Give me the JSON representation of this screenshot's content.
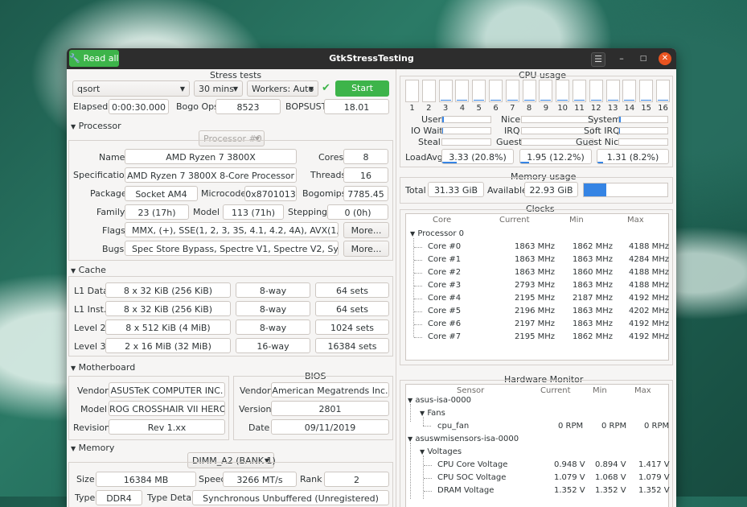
{
  "window": {
    "title": "GtkStressTesting",
    "read_all": "Read all"
  },
  "stress": {
    "title": "Stress tests",
    "method": "qsort",
    "duration": "30 mins",
    "workers": "Workers: Auto",
    "start": "Start",
    "elapsed_label": "Elapsed",
    "elapsed": "0:00:30.000",
    "bogo_label": "Bogo Ops",
    "bogo": "8523",
    "bopsust_label": "BOPSUST",
    "bopsust": "18.01"
  },
  "processor": {
    "title": "Processor",
    "selector": "Processor #0",
    "name_label": "Name",
    "name": "AMD Ryzen 7 3800X",
    "cores_label": "Cores",
    "cores": "8",
    "spec_label": "Specification",
    "spec": "AMD Ryzen 7 3800X 8-Core Processor",
    "threads_label": "Threads",
    "threads": "16",
    "package_label": "Package",
    "package": "Socket AM4",
    "microcode_label": "Microcode",
    "microcode": "0x8701013",
    "bogomips_label": "Bogomips",
    "bogomips": "7785.45",
    "family_label": "Family",
    "family": "23 (17h)",
    "model_label": "Model",
    "model": "113 (71h)",
    "stepping_label": "Stepping",
    "stepping": "0 (0h)",
    "flags_label": "Flags",
    "flags": "MMX, (+), SSE(1, 2, 3, 3S, 4.1, 4.2, 4A), AVX(1, 2), AES, CLM",
    "more1": "More...",
    "bugs_label": "Bugs",
    "bugs": "Spec Store Bypass, Spectre V1, Spectre V2, Sysret Ss Att",
    "more2": "More..."
  },
  "cache": {
    "title": "Cache",
    "rows": [
      {
        "label": "L1 Data",
        "size": "8 x 32 KiB (256 KiB)",
        "way": "8-way",
        "sets": "64 sets"
      },
      {
        "label": "L1 Inst.",
        "size": "8 x 32 KiB (256 KiB)",
        "way": "8-way",
        "sets": "64 sets"
      },
      {
        "label": "Level 2",
        "size": "8 x 512 KiB (4 MiB)",
        "way": "8-way",
        "sets": "1024 sets"
      },
      {
        "label": "Level 3",
        "size": "2 x 16 MiB (32 MiB)",
        "way": "16-way",
        "sets": "16384 sets"
      }
    ]
  },
  "motherboard": {
    "title": "Motherboard",
    "vendor_label": "Vendor",
    "vendor": "ASUSTeK COMPUTER INC.",
    "model_label": "Model",
    "model": "ROG CROSSHAIR VII HERO",
    "revision_label": "Revision",
    "revision": "Rev 1.xx",
    "bios_title": "BIOS",
    "bios_vendor_label": "Vendor",
    "bios_vendor": "American Megatrends Inc.",
    "version_label": "Version",
    "version": "2801",
    "date_label": "Date",
    "date": "09/11/2019"
  },
  "memory": {
    "title": "Memory",
    "selector": "DIMM_A2 (BANK 1)",
    "size_label": "Size",
    "size": "16384 MB",
    "speed_label": "Speed",
    "speed": "3266 MT/s",
    "rank_label": "Rank",
    "rank": "2",
    "type_label": "Type",
    "type": "DDR4",
    "detail_label": "Type Detail",
    "detail": "Synchronous Unbuffered (Unregistered)"
  },
  "cpu_usage": {
    "title": "CPU usage",
    "cores": [
      "1",
      "2",
      "3",
      "4",
      "5",
      "6",
      "7",
      "8",
      "9",
      "10",
      "11",
      "12",
      "13",
      "14",
      "15",
      "16"
    ],
    "core_levels": [
      0,
      0,
      0.05,
      0.05,
      0.05,
      0.05,
      0.05,
      0.05,
      0.05,
      0.05,
      0.05,
      0.05,
      0.05,
      0.05,
      0.05,
      0.05
    ],
    "user_label": "User",
    "nice_label": "Nice",
    "system_label": "System",
    "iowait_label": "IO Wait",
    "irq_label": "IRQ",
    "softirq_label": "Soft IRQ",
    "steal_label": "Steal",
    "guest_label": "Guest",
    "guestnice_label": "Guest Nice",
    "loadavg_label": "LoadAvg",
    "load1": "3.33 (20.8%)",
    "load5": "1.95 (12.2%)",
    "load15": "1.31 (8.2%)",
    "load_levels": [
      0.208,
      0.122,
      0.082
    ]
  },
  "memory_usage": {
    "title": "Memory usage",
    "total_label": "Total",
    "total": "31.33 GiB",
    "available_label": "Available",
    "available": "22.93 GiB",
    "used_fraction": 0.27
  },
  "clocks": {
    "title": "Clocks",
    "headers": [
      "Core",
      "Current",
      "Min",
      "Max"
    ],
    "group": "Processor 0",
    "rows": [
      {
        "core": "Core #0",
        "current": "1863 MHz",
        "min": "1862 MHz",
        "max": "4188 MHz"
      },
      {
        "core": "Core #1",
        "current": "1863 MHz",
        "min": "1863 MHz",
        "max": "4284 MHz"
      },
      {
        "core": "Core #2",
        "current": "1863 MHz",
        "min": "1860 MHz",
        "max": "4188 MHz"
      },
      {
        "core": "Core #3",
        "current": "2793 MHz",
        "min": "1863 MHz",
        "max": "4188 MHz"
      },
      {
        "core": "Core #4",
        "current": "2195 MHz",
        "min": "2187 MHz",
        "max": "4192 MHz"
      },
      {
        "core": "Core #5",
        "current": "2196 MHz",
        "min": "1863 MHz",
        "max": "4202 MHz"
      },
      {
        "core": "Core #6",
        "current": "2197 MHz",
        "min": "1863 MHz",
        "max": "4192 MHz"
      },
      {
        "core": "Core #7",
        "current": "2195 MHz",
        "min": "1862 MHz",
        "max": "4192 MHz"
      }
    ]
  },
  "hwmon": {
    "title": "Hardware Monitor",
    "headers": [
      "Sensor",
      "Current",
      "Min",
      "Max"
    ],
    "isa": "asus-isa-0000",
    "fans": "Fans",
    "fan_name": "cpu_fan",
    "fan_cur": "0 RPM",
    "fan_min": "0 RPM",
    "fan_max": "0 RPM",
    "wmi": "asuswmisensors-isa-0000",
    "voltages": "Voltages",
    "rows": [
      {
        "name": "CPU Core Voltage",
        "current": "0.948 V",
        "min": "0.894 V",
        "max": "1.417 V"
      },
      {
        "name": "CPU SOC Voltage",
        "current": "1.079 V",
        "min": "1.068 V",
        "max": "1.079 V"
      },
      {
        "name": "DRAM Voltage",
        "current": "1.352 V",
        "min": "1.352 V",
        "max": "1.352 V"
      }
    ]
  }
}
